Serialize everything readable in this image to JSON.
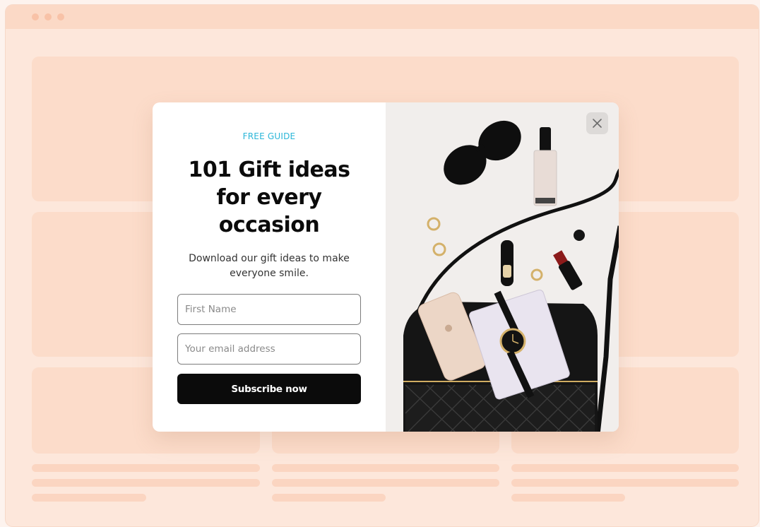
{
  "popup": {
    "eyebrow": "FREE GUIDE",
    "headline": "101 Gift ideas for every occasion",
    "subtext": "Download our gift ideas to make everyone smile.",
    "first_name_placeholder": "First Name",
    "email_placeholder": "Your email address",
    "subscribe_label": "Subscribe now",
    "close_icon": "close-icon",
    "accent_color": "#2ab6d8",
    "button_color": "#0b0b0b"
  },
  "background": {
    "page_color": "#fde7db",
    "placeholder_color": "#fcdcca"
  }
}
